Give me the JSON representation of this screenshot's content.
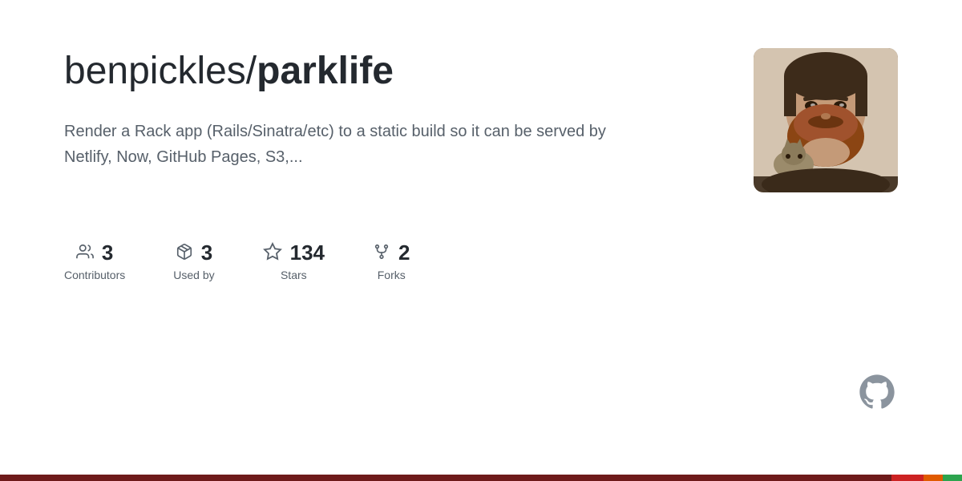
{
  "repo": {
    "owner": "benpickles/",
    "name": "parklife",
    "description": "Render a Rack app (Rails/Sinatra/etc) to a static build so it can be served by Netlify, Now, GitHub Pages, S3,...",
    "title_full": "benpickles/parklife"
  },
  "stats": [
    {
      "id": "contributors",
      "number": "3",
      "label": "Contributors",
      "icon": "contributors-icon"
    },
    {
      "id": "used-by",
      "number": "3",
      "label": "Used by",
      "icon": "package-icon"
    },
    {
      "id": "stars",
      "number": "134",
      "label": "Stars",
      "icon": "star-icon"
    },
    {
      "id": "forks",
      "number": "2",
      "label": "Forks",
      "icon": "fork-icon"
    }
  ],
  "colors": {
    "background": "#ffffff",
    "title": "#24292f",
    "description": "#57606a",
    "stat_number": "#24292f",
    "stat_label": "#57606a",
    "github_icon": "#8b949e",
    "bar_dark_red": "#6e1a1a",
    "bar_red": "#cc2222",
    "bar_orange": "#e05a00",
    "bar_green": "#2da44e"
  }
}
